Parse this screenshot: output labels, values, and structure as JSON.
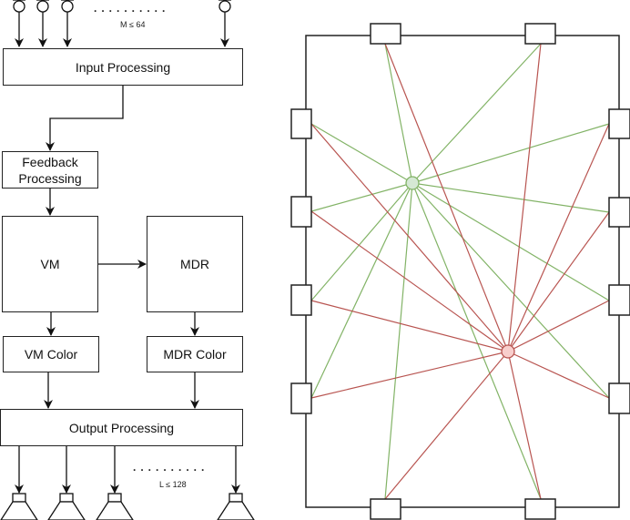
{
  "left_diagram": {
    "input_processing": "Input Processing",
    "feedback_processing": "Feedback Processing",
    "vm": "VM",
    "mdr": "MDR",
    "vm_color": "VM Color",
    "mdr_color": "MDR Color",
    "output_processing": "Output Processing",
    "input_count_label": "M ≤ 64",
    "output_count_label": "L ≤ 128",
    "ellipsis": "..........",
    "input_icon": "microphone-icon",
    "output_icon": "speaker-icon"
  },
  "right_diagram": {
    "sources": [
      {
        "name": "green-source",
        "color": "#82b366",
        "fill": "#d5e8d4"
      },
      {
        "name": "red-source",
        "color": "#b85450",
        "fill": "#f8cecc"
      }
    ],
    "speakers": [
      "top-1",
      "top-2",
      "left-1",
      "left-2",
      "left-3",
      "left-4",
      "right-1",
      "right-2",
      "right-3",
      "right-4",
      "bottom-1",
      "bottom-2"
    ]
  }
}
